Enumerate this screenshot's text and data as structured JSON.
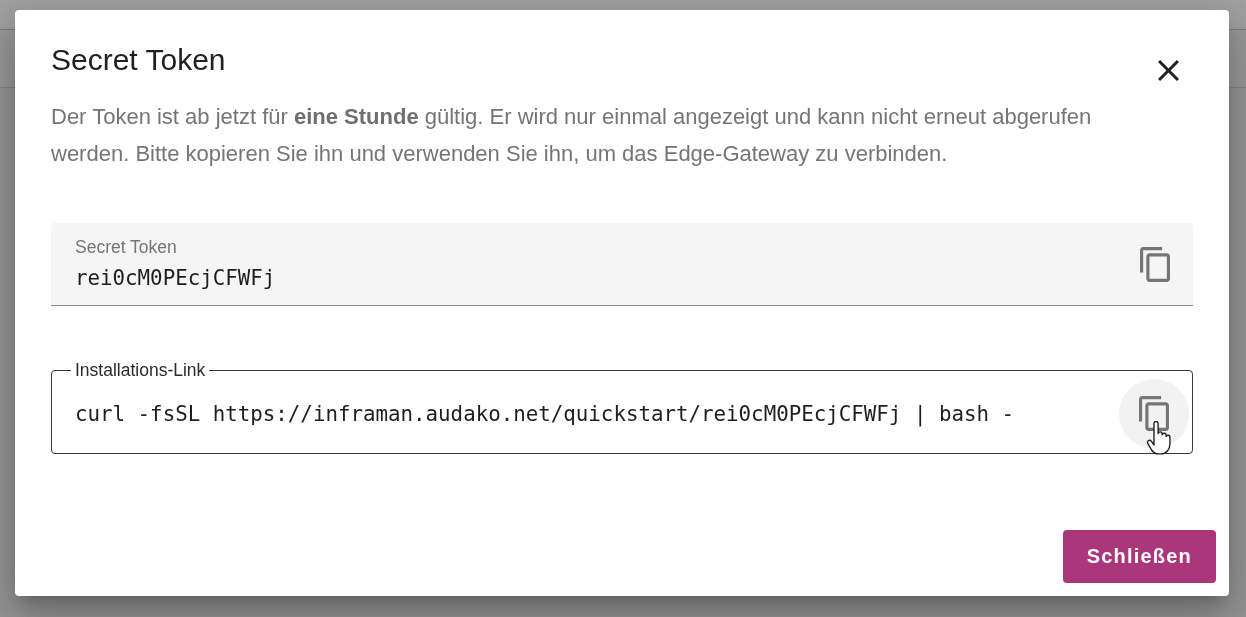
{
  "dialog": {
    "title": "Secret Token",
    "description": "Der Token ist ab jetzt für **eine Stunde** gültig. Er wird nur einmal angezeigt und kann nicht erneut abgerufen werden. Bitte kopieren Sie ihn und verwenden Sie ihn, um das Edge-Gateway zu verbinden.",
    "fields": [
      {
        "kind": "filled",
        "label": "Secret Token",
        "value": "rei0cM0PEcjCFWFj",
        "copy_hovered": false
      },
      {
        "kind": "outlined",
        "label": "Installations-Link",
        "value": "curl -fsSL https://inframan.audako.net/quickstart/rei0cM0PEcjCFWFj | bash -",
        "copy_hovered": true
      }
    ],
    "buttons": [
      {
        "kind": "primary",
        "label": "Schließen"
      }
    ]
  }
}
